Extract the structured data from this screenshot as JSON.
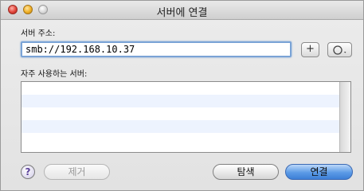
{
  "window": {
    "title": "서버에 연결"
  },
  "server_address": {
    "label": "서버 주소:",
    "value": "smb://192.168.10.37",
    "add_icon": "plus-icon",
    "history_icon": "clock-dropdown-icon"
  },
  "favorites": {
    "label": "자주 사용하는 서버:",
    "rows": 5
  },
  "footer": {
    "help_glyph": "?",
    "remove_label": "제거",
    "browse_label": "탐색",
    "connect_label": "연결"
  },
  "colors": {
    "accent_blue": "#5b9ae6",
    "list_alt_row": "#edf3fe",
    "focus_ring": "#7aa3d6"
  }
}
